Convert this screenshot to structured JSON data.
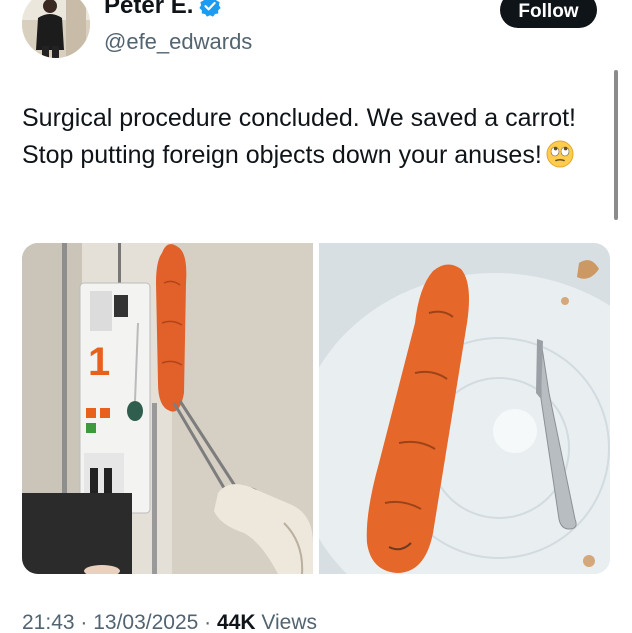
{
  "author": {
    "display_name": "Peter E.",
    "handle": "@efe_edwards",
    "avatar_icon": "avatar",
    "verified_icon": "verified-badge-icon"
  },
  "follow_button": {
    "label": "Follow"
  },
  "tweet": {
    "text": "Surgical procedure concluded. We saved a carrot! Stop putting foreign objects down your anuses!",
    "emoji_icon": "face-with-rolling-eyes-emoji"
  },
  "media": [
    {
      "icon": "photo-carrot-held-with-forceps"
    },
    {
      "icon": "photo-carrot-on-tray-with-scalpel"
    }
  ],
  "meta": {
    "time": "21:43",
    "separator": " · ",
    "date": "13/03/2025",
    "views_count": "44K",
    "views_label": "Views"
  },
  "colors": {
    "text_primary": "#0f1419",
    "text_secondary": "#536471",
    "verified_blue": "#1d9bf0",
    "follow_bg": "#0f1419"
  }
}
